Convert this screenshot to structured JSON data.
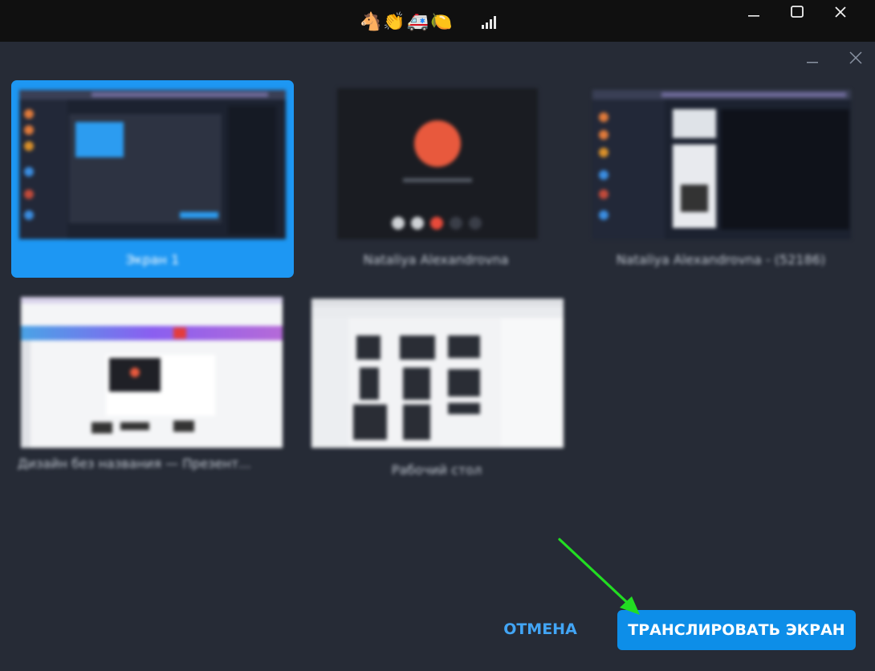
{
  "titlebar": {
    "emojis": [
      "🐴",
      "👏",
      "🚑",
      "🍋"
    ],
    "minimize_glyph": "—",
    "close_glyph": "✕"
  },
  "tiles": [
    {
      "label": "Экран 1",
      "selected": true
    },
    {
      "label": "Nataliya Alexandrovna",
      "selected": false
    },
    {
      "label": "Nataliya Alexandrovna - (52186)",
      "selected": false
    },
    {
      "label": "Дизайн без названия — Презент...",
      "selected": false
    },
    {
      "label": "Рабочий стол",
      "selected": false
    }
  ],
  "actions": {
    "cancel_label": "ОТМЕНА",
    "cast_label": "ТРАНСЛИРОВАТЬ ЭКРАН"
  },
  "colors": {
    "accent": "#0d8ee8",
    "selection": "#1d97f3",
    "annotation_arrow": "#22dd22",
    "dialog_bg": "#262b36"
  }
}
